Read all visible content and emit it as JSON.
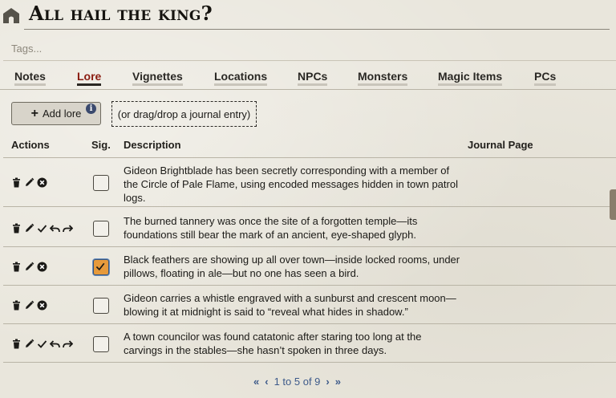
{
  "title": "All hail the king?",
  "tags": {
    "placeholder": "Tags..."
  },
  "tabs": [
    {
      "label": "Notes"
    },
    {
      "label": "Lore"
    },
    {
      "label": "Vignettes"
    },
    {
      "label": "Locations"
    },
    {
      "label": "NPCs"
    },
    {
      "label": "Monsters"
    },
    {
      "label": "Magic Items"
    },
    {
      "label": "PCs"
    }
  ],
  "active_tab": "Lore",
  "toolbar": {
    "add_label": "Add lore",
    "drop_hint": "(or drag/drop a journal entry)"
  },
  "table": {
    "headers": {
      "actions": "Actions",
      "sig": "Sig.",
      "description": "Description",
      "journal": "Journal Page"
    },
    "rows": [
      {
        "description": "Gideon Brightblade has been secretly corresponding with a member of the Circle of Pale Flame, using encoded messages hidden in town patrol logs.",
        "significant": false,
        "journal_page": ""
      },
      {
        "description": "The burned tannery was once the site of a forgotten temple—its foundations still bear the mark of an ancient, eye-shaped glyph.",
        "significant": false,
        "journal_page": ""
      },
      {
        "description": "Black feathers are showing up all over town—inside locked rooms, under pillows, floating in ale—but no one has seen a bird.",
        "significant": true,
        "journal_page": ""
      },
      {
        "description": "Gideon carries a whistle engraved with a sunburst and crescent moon—blowing it at midnight is said to “reveal what hides in shadow.”",
        "significant": false,
        "journal_page": ""
      },
      {
        "description": "A town councilor was found catatonic after staring too long at the carvings in the stables—she hasn’t spoken in three days.",
        "significant": false,
        "journal_page": ""
      }
    ]
  },
  "pagination": {
    "first": "«",
    "prev": "‹",
    "label": "1 to 5 of 9",
    "next": "›",
    "last": "»"
  },
  "colors": {
    "accent": "#8a1c10",
    "checkbox_checked": "#e69a3c",
    "pager": "#3d5a8a"
  }
}
